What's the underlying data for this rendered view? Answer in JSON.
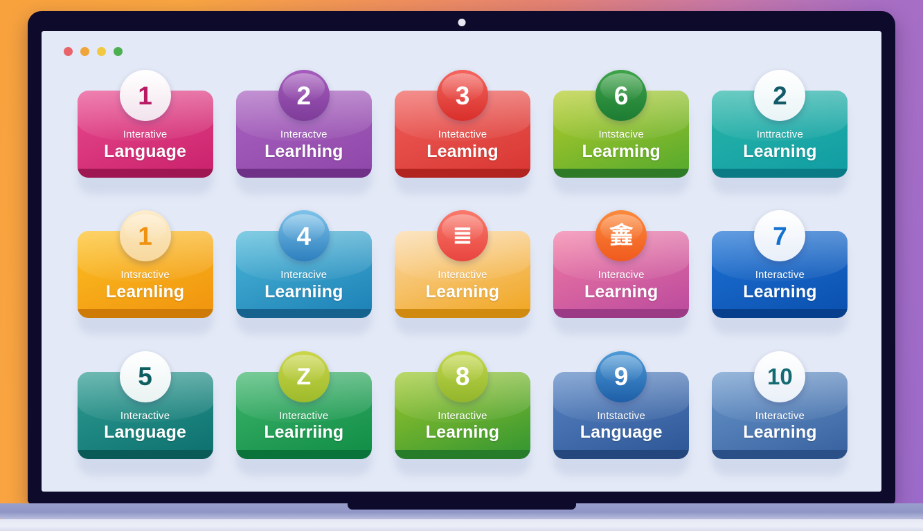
{
  "window": {
    "traffic_lights": [
      {
        "name": "close",
        "color": "#e9646a"
      },
      {
        "name": "minimize",
        "color": "#f0a53a"
      },
      {
        "name": "maximize",
        "color": "#f2c842"
      },
      {
        "name": "extra",
        "color": "#4cb050"
      }
    ]
  },
  "device": {
    "frame_color": "#0d0a2c",
    "base_color": "#9aa0cb",
    "screen_background": "#e3e9f6"
  },
  "backdrop": {
    "gradient_from": "#f8a23e",
    "gradient_mid": "#e48274",
    "gradient_to": "#9b6ac9"
  },
  "cards": [
    {
      "badge": "1",
      "badge_is_glyph": false,
      "subtitle": "Interative",
      "title": "Language",
      "card_from": "#e84b8e",
      "card_to": "#c9206b",
      "badge_bg_from": "#ffffff",
      "badge_bg_to": "#f2e3ec",
      "badge_text_color": "#b81a64",
      "lip_color": "#9e1752"
    },
    {
      "badge": "2",
      "badge_is_glyph": false,
      "subtitle": "Interactve",
      "title": "Learlhing",
      "card_from": "#a963c0",
      "card_to": "#8e46a8",
      "badge_bg_from": "#a65cbd",
      "badge_bg_to": "#7e3c99",
      "badge_text_color": "#ffffff",
      "lip_color": "#6f3088"
    },
    {
      "badge": "3",
      "badge_is_glyph": false,
      "subtitle": "Intetactive",
      "title": "Leaming",
      "card_from": "#ef5f5b",
      "card_to": "#d83530",
      "badge_bg_from": "#f4655e",
      "badge_bg_to": "#d92f2b",
      "badge_text_color": "#ffffff",
      "lip_color": "#b22420"
    },
    {
      "badge": "6",
      "badge_is_glyph": false,
      "subtitle": "Intstacive",
      "title": "Learming",
      "card_from": "#b5cc2a",
      "card_to": "#52a82e",
      "badge_bg_from": "#3fa349",
      "badge_bg_to": "#1d7c33",
      "badge_text_color": "#ffffff",
      "lip_color": "#2f7a26"
    },
    {
      "badge": "2",
      "badge_is_glyph": false,
      "subtitle": "Inttractive",
      "title": "Learning",
      "card_from": "#2bb6a8",
      "card_to": "#0f9ca3",
      "badge_bg_from": "#ffffff",
      "badge_bg_to": "#e9f4f6",
      "badge_text_color": "#125b68",
      "lip_color": "#0a7a84"
    },
    {
      "badge": "1",
      "badge_is_glyph": false,
      "subtitle": "Intsractive",
      "title": "Learnling",
      "card_from": "#fcc023",
      "card_to": "#f0920d",
      "badge_bg_from": "#fdeccb",
      "badge_bg_to": "#f7d89d",
      "badge_text_color": "#ef9212",
      "lip_color": "#cd7a06"
    },
    {
      "badge": "4",
      "badge_is_glyph": false,
      "subtitle": "Interacive",
      "title": "Learniing",
      "card_from": "#4cb7d8",
      "card_to": "#1b7fb5",
      "badge_bg_from": "#7ec3ea",
      "badge_bg_to": "#2d7fbe",
      "badge_text_color": "#ffffff",
      "lip_color": "#15628f"
    },
    {
      "badge": "≣",
      "badge_is_glyph": true,
      "subtitle": "Interactive",
      "title": "Learning",
      "card_from": "#fbd9a8",
      "card_to": "#f0a41c",
      "badge_bg_from": "#f97a6b",
      "badge_bg_to": "#e8453f",
      "badge_text_color": "#ffffff",
      "lip_color": "#d08a10"
    },
    {
      "badge": "錱",
      "badge_is_glyph": true,
      "subtitle": "Interacive",
      "title": "Learning",
      "card_from": "#f27ba3",
      "card_to": "#b9499e",
      "badge_bg_from": "#fb8a3c",
      "badge_bg_to": "#f05a1e",
      "badge_text_color": "#ffffff",
      "lip_color": "#9c3b85"
    },
    {
      "badge": "7",
      "badge_is_glyph": false,
      "subtitle": "Interactive",
      "title": "Learning",
      "card_from": "#1d72d4",
      "card_to": "#0a4fae",
      "badge_bg_from": "#ffffff",
      "badge_bg_to": "#e8eff9",
      "badge_text_color": "#1472cf",
      "lip_color": "#083f8c"
    },
    {
      "badge": "5",
      "badge_is_glyph": false,
      "subtitle": "Interactive",
      "title": "Language",
      "card_from": "#2f9c92",
      "card_to": "#0c6f6d",
      "badge_bg_from": "#ffffff",
      "badge_bg_to": "#e9f3f2",
      "badge_text_color": "#0e5e60",
      "lip_color": "#0a5a58"
    },
    {
      "badge": "Z",
      "badge_is_glyph": true,
      "subtitle": "Interactive",
      "title": "Leairriing",
      "card_from": "#3fb56c",
      "card_to": "#0f8c45",
      "badge_bg_from": "#cbd64a",
      "badge_bg_to": "#9dbb2b",
      "badge_text_color": "#ffffff",
      "lip_color": "#0a7339"
    },
    {
      "badge": "8",
      "badge_is_glyph": false,
      "subtitle": "Interactive",
      "title": "Learning",
      "card_from": "#9ec72b",
      "card_to": "#2f9432",
      "badge_bg_from": "#c4d84c",
      "badge_bg_to": "#92b62c",
      "badge_text_color": "#ffffff",
      "lip_color": "#277c2a"
    },
    {
      "badge": "9",
      "badge_is_glyph": false,
      "subtitle": "Intstactive",
      "title": "Language",
      "card_from": "#5a86c4",
      "card_to": "#2b5494",
      "badge_bg_from": "#4e9bd8",
      "badge_bg_to": "#1e5fa8",
      "badge_text_color": "#ffffff",
      "lip_color": "#24477e"
    },
    {
      "badge": "10",
      "badge_is_glyph": false,
      "subtitle": "Interactive",
      "title": "Learning",
      "card_from": "#6a97cb",
      "card_to": "#36609e",
      "badge_bg_from": "#ffffff",
      "badge_bg_to": "#eaf0f8",
      "badge_text_color": "#136a72",
      "lip_color": "#2b5087"
    }
  ]
}
